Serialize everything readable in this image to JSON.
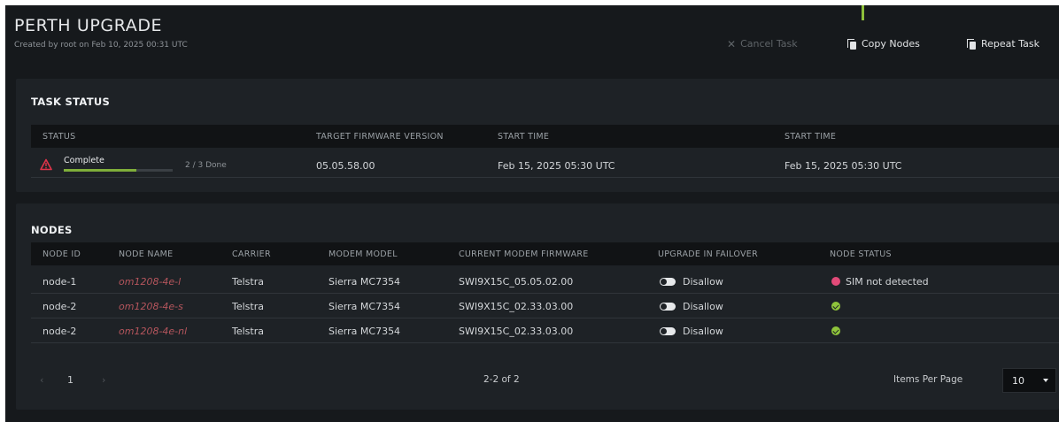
{
  "header": {
    "title": "PERTH UPGRADE",
    "subtitle": "Created by root on Feb 10, 2025 00:31 UTC",
    "actions": {
      "cancel": "Cancel Task",
      "copy": "Copy Nodes",
      "repeat": "Repeat Task"
    }
  },
  "task_status": {
    "title": "TASK STATUS",
    "columns": [
      "STATUS",
      "TARGET FIRMWARE VERSION",
      "START TIME",
      "START TIME"
    ],
    "row": {
      "status": "Complete",
      "progress_fraction": 0.6667,
      "done": "2 / 3 Done",
      "target_firmware": "05.05.58.00",
      "start_time_1": "Feb 15, 2025 05:30 UTC",
      "start_time_2": "Feb 15, 2025 05:30 UTC"
    }
  },
  "nodes": {
    "title": "NODES",
    "columns": [
      "NODE ID",
      "NODE NAME",
      "CARRIER",
      "MODEM MODEL",
      "CURRENT MODEM FIRMWARE",
      "UPGRADE IN FAILOVER",
      "NODE STATUS"
    ],
    "rows": [
      {
        "id": "node-1",
        "name": "om1208-4e-l",
        "carrier": "Telstra",
        "model": "Sierra MC7354",
        "firmware": "SWI9X15C_05.05.02.00",
        "failover": "Disallow",
        "status": "SIM not detected",
        "status_type": "error"
      },
      {
        "id": "node-2",
        "name": "om1208-4e-s",
        "carrier": "Telstra",
        "model": "Sierra MC7354",
        "firmware": "SWI9X15C_02.33.03.00",
        "failover": "Disallow",
        "status": "",
        "status_type": "ok"
      },
      {
        "id": "node-2",
        "name": "om1208-4e-nl",
        "carrier": "Telstra",
        "model": "Sierra MC7354",
        "firmware": "SWI9X15C_02.33.03.00",
        "failover": "Disallow",
        "status": "",
        "status_type": "ok"
      }
    ]
  },
  "pagination": {
    "prev": "‹",
    "page": "1",
    "next": "›",
    "range": "2-2 of 2",
    "items_per_page_label": "Items Per Page",
    "items_per_page_value": "10"
  },
  "colors": {
    "background": "#16191c",
    "panel": "#1e2226",
    "accent_green": "#8dbf3a",
    "link_red": "#b4555c",
    "error_pink": "#e24a78",
    "warning_red": "#e0344a"
  },
  "icons": {
    "cancel": "close-icon",
    "copy": "copy-icon",
    "repeat": "copy-icon",
    "status_warning": "warning-triangle-icon",
    "node_error": "red-dot-icon",
    "node_ok": "check-circle-icon"
  }
}
